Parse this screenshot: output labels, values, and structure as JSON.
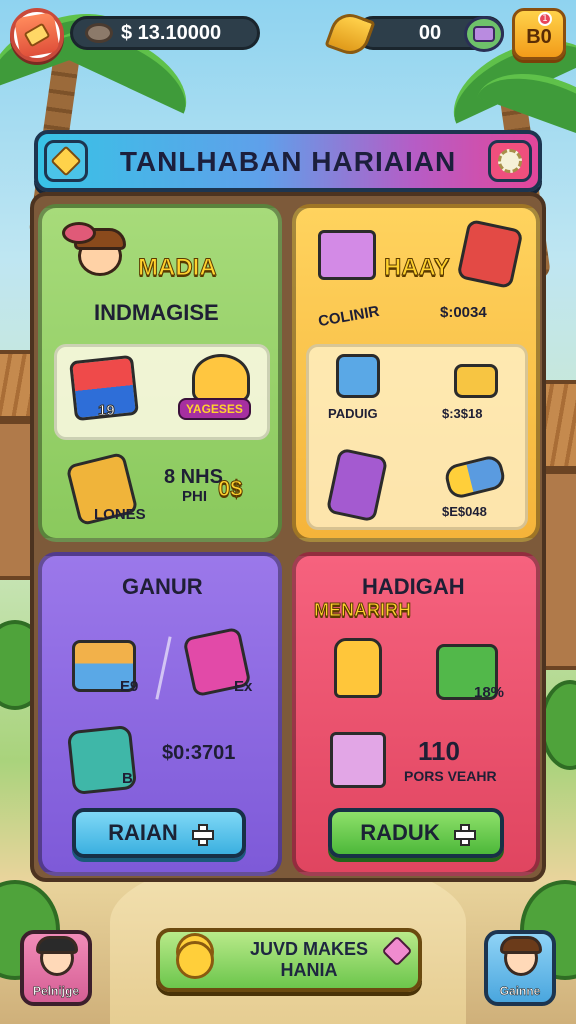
{
  "top_bar": {
    "coins_value": "$ 13.10000",
    "gems_value": "00",
    "badge_label": "B0",
    "notification_count": "1"
  },
  "title_banner": {
    "title": "TANLHABAN HARIAIAN"
  },
  "panels": {
    "green": {
      "heading": "MADIA",
      "subtitle": "INDMAGISE",
      "item1_label": "19",
      "item2_label": "YAGESES",
      "item3_label": "LONES",
      "item3_value_line1": "8 NHS",
      "item3_value_line2": "PHI",
      "item3_value_extra": "0$"
    },
    "orange": {
      "heading": "HAAY",
      "label_left": "COLINIR",
      "label_right": "$:0034",
      "item1_label": "PADUIG",
      "item2_label": "$:3$18",
      "item3_label": "$E$048"
    },
    "purple": {
      "heading": "GANUR",
      "item1_label": "E9",
      "item2_label": "Ex",
      "item3_label": "B",
      "value": "$0:3701",
      "button_label": "RAIAN"
    },
    "red": {
      "heading": "HADIGAH",
      "subtitle": "MENARIRH",
      "item2_label": "18%",
      "value_big": "110",
      "value_small": "PORS VEAHR",
      "button_label": "RADUK"
    }
  },
  "bottom_bar": {
    "left_label": "Pelnijge",
    "center_label": "JUVD MAKES HANIA",
    "right_label": "Gainne"
  },
  "colors": {
    "title_gradient": [
      "#38c3e6",
      "#b55dc6",
      "#e3469a"
    ],
    "panel_green": "#8ac95d",
    "panel_orange": "#f5b43a",
    "panel_purple": "#7e5ad8",
    "panel_red": "#e04560",
    "button_blue": "#3bb0e0",
    "button_green": "#4db83a"
  }
}
